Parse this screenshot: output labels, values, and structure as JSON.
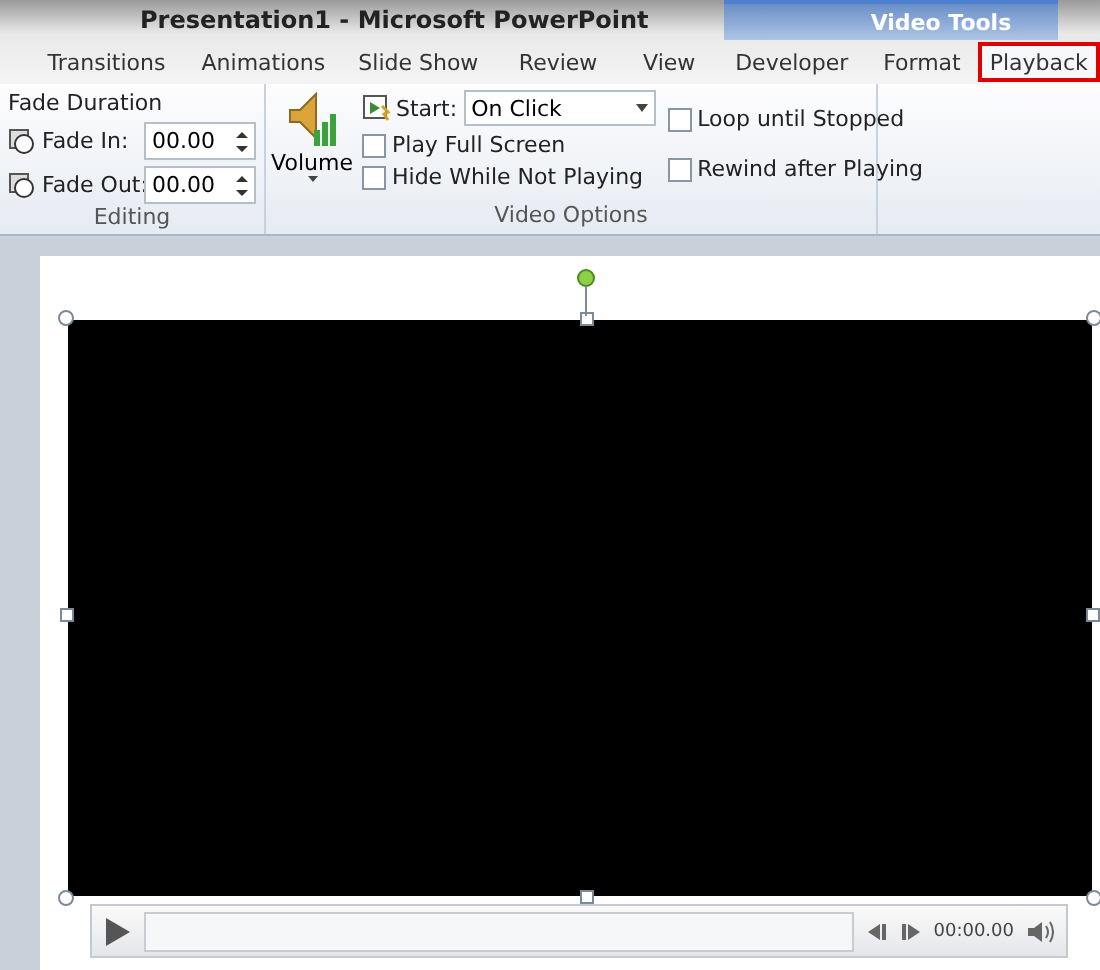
{
  "window": {
    "title": "Presentation1  -  Microsoft PowerPoint"
  },
  "contextual_group": {
    "label": "Video Tools"
  },
  "tabs": [
    {
      "label": "Transitions",
      "selected": false
    },
    {
      "label": "Animations",
      "selected": false
    },
    {
      "label": "Slide Show",
      "selected": false
    },
    {
      "label": "Review",
      "selected": false
    },
    {
      "label": "View",
      "selected": false
    },
    {
      "label": "Developer",
      "selected": false
    },
    {
      "label": "Format",
      "selected": false
    },
    {
      "label": "Playback",
      "selected": true
    }
  ],
  "editing": {
    "heading": "Fade Duration",
    "fields": [
      {
        "label": "Fade In:",
        "value": "00.00"
      },
      {
        "label": "Fade Out:",
        "value": "00.00"
      }
    ],
    "group_label": "Editing"
  },
  "video_options": {
    "volume_label": "Volume",
    "start_label": "Start:",
    "start_value": "On Click",
    "checkboxes": [
      {
        "label": "Play Full Screen",
        "checked": false
      },
      {
        "label": "Hide While Not Playing",
        "checked": false
      }
    ],
    "checkboxes_right": [
      {
        "label": "Loop until Stopped",
        "checked": false
      },
      {
        "label": "Rewind after Playing",
        "checked": false
      }
    ],
    "group_label": "Video Options"
  },
  "player": {
    "time": "00:00.00"
  }
}
